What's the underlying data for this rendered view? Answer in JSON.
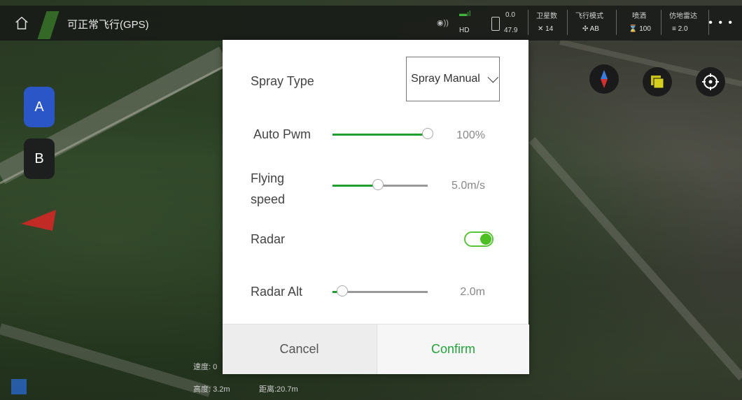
{
  "topbar": {
    "status": "可正常飞行(GPS)",
    "link_hd": "HD",
    "battery_top": "0.0",
    "battery_bottom": "47.9",
    "satellites_label": "卫星数",
    "satellites_value": "14",
    "flight_mode_label": "飞行模式",
    "flight_mode_value": "AB",
    "spray_label": "喷洒",
    "spray_value": "100",
    "terrain_radar_label": "仿地雷达",
    "terrain_radar_value": "2.0",
    "more": "• • •"
  },
  "side": {
    "a_label": "A",
    "b_label": "B"
  },
  "bottom": {
    "speed": "速度: 0",
    "altitude": "高度: 3.2m",
    "distance": "距离:20.7m"
  },
  "dialog": {
    "spray_type_label": "Spray Type",
    "spray_type_value": "Spray Manual",
    "auto_pwm_label": "Auto Pwm",
    "auto_pwm_value": "100%",
    "auto_pwm_level": 1.0,
    "flying_speed_label_1": "Flying",
    "flying_speed_label_2": "speed",
    "flying_speed_value": "5.0m/s",
    "flying_speed_level": 0.48,
    "radar_label": "Radar",
    "radar_on": true,
    "radar_alt_label": "Radar Alt",
    "radar_alt_value": "2.0m",
    "radar_alt_level": 0.1,
    "cancel_label": "Cancel",
    "confirm_label": "Confirm"
  },
  "colors": {
    "accent_green": "#1f9d2e",
    "confirm_green": "#22a33a",
    "toggle_green": "#4cbf24",
    "a_button_blue": "#2a56c8"
  }
}
